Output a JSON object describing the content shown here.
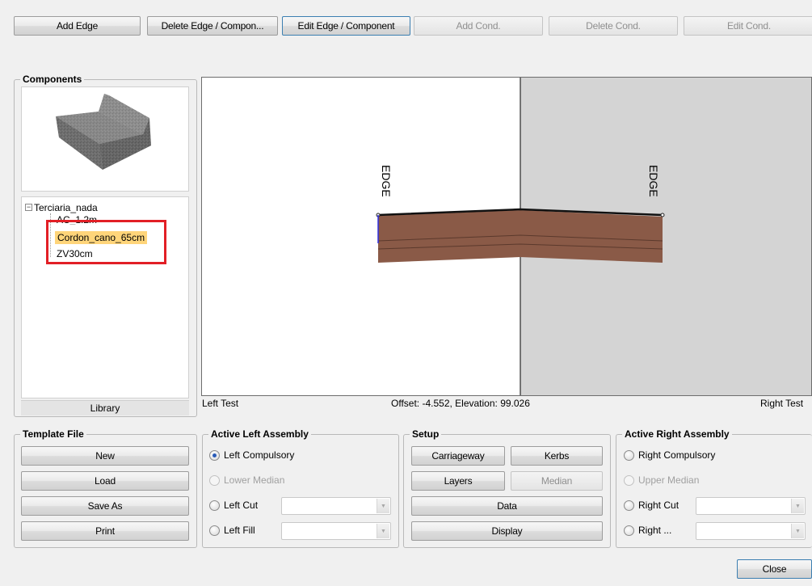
{
  "toolbar": {
    "add_edge": "Add Edge",
    "delete_edge": "Delete Edge / Compon...",
    "edit_edge": "Edit Edge / Component",
    "add_cond": "Add Cond.",
    "delete_cond": "Delete Cond.",
    "edit_cond": "Edit Cond."
  },
  "components": {
    "title": "Components",
    "tree": {
      "root": "Terciaria_nada",
      "expander": "−",
      "items": [
        "AC_1.2m",
        "Cordon_cano_65cm",
        "ZV30cm"
      ],
      "selected_index": 1
    },
    "library_tab": "Library"
  },
  "canvas": {
    "edge_label_left": "EDGE",
    "edge_label_right": "EDGE",
    "left_caption": "Left Test",
    "status": "Offset: -4.552, Elevation: 99.026",
    "right_caption": "Right Test",
    "colors": {
      "left_bg": "#ffffff",
      "right_bg": "#d4d4d4",
      "layer": "#8a5a47",
      "highlight": "#e21f26",
      "selected": "#ffd57a"
    }
  },
  "template_file": {
    "title": "Template File",
    "new": "New",
    "load": "Load",
    "save_as": "Save As",
    "print": "Print"
  },
  "left_assembly": {
    "title": "Active Left Assembly",
    "compulsory": "Left Compulsory",
    "lower_median": "Lower Median",
    "cut": "Left Cut",
    "fill": "Left Fill"
  },
  "setup": {
    "title": "Setup",
    "carriageway": "Carriageway",
    "kerbs": "Kerbs",
    "layers": "Layers",
    "median": "Median",
    "data": "Data",
    "display": "Display"
  },
  "right_assembly": {
    "title": "Active Right Assembly",
    "compulsory": "Right Compulsory",
    "upper_median": "Upper Median",
    "cut": "Right Cut",
    "fill": "Right ..."
  },
  "footer": {
    "close": "Close"
  }
}
